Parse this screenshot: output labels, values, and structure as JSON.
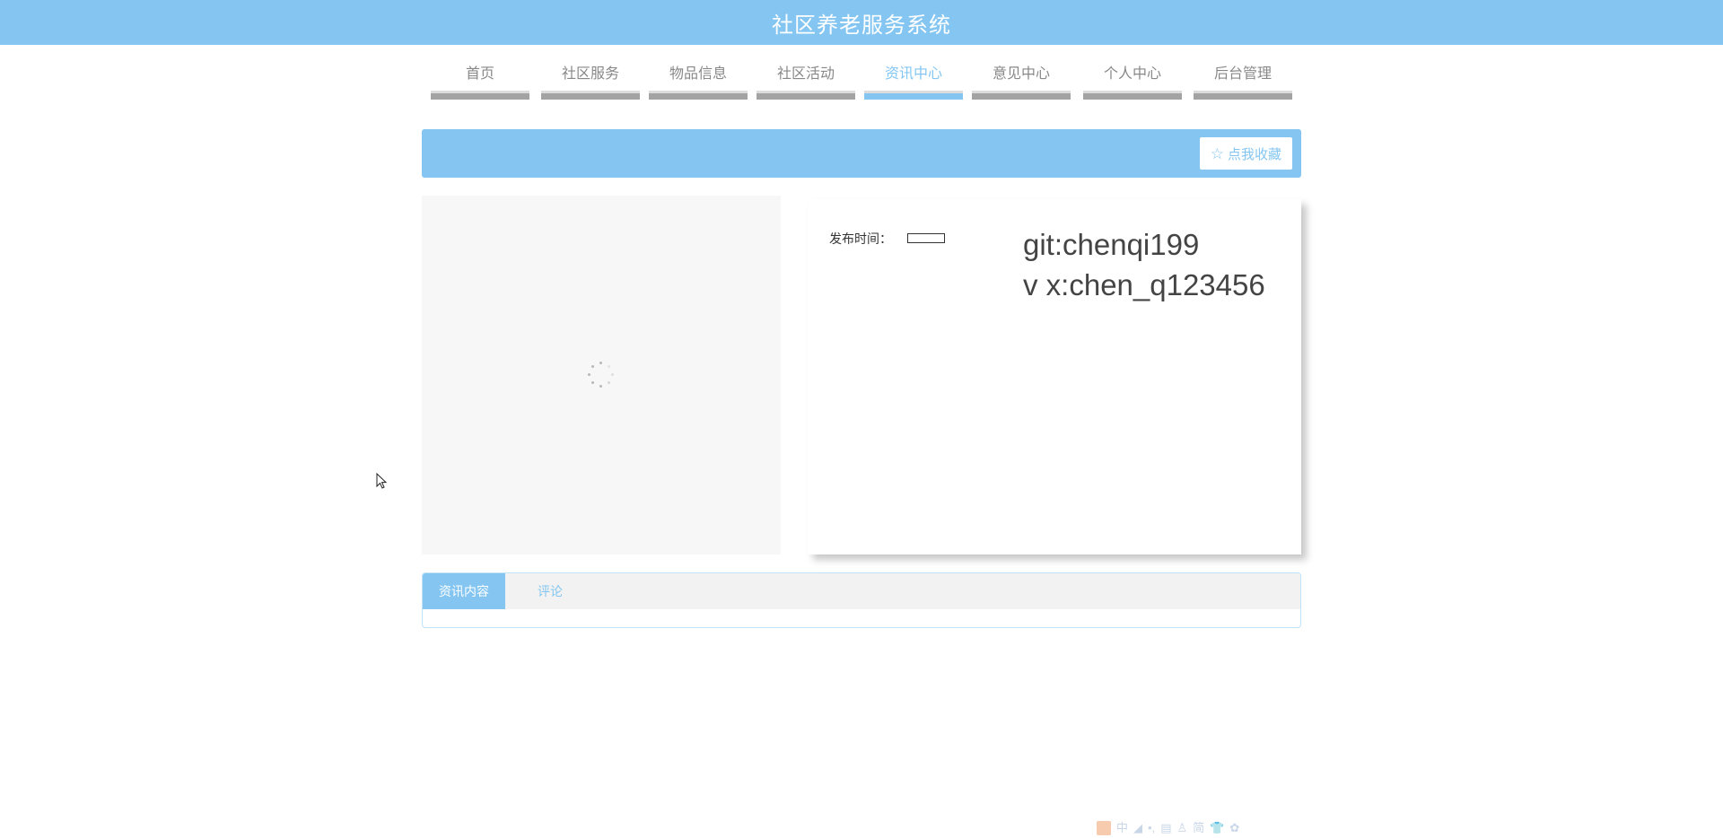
{
  "header": {
    "title": "社区养老服务系统"
  },
  "nav": {
    "items": [
      {
        "label": "首页",
        "active": false
      },
      {
        "label": "社区服务",
        "active": false
      },
      {
        "label": "物品信息",
        "active": false
      },
      {
        "label": "社区活动",
        "active": false
      },
      {
        "label": "资讯中心",
        "active": true
      },
      {
        "label": "意见中心",
        "active": false
      },
      {
        "label": "个人中心",
        "active": false
      },
      {
        "label": "后台管理",
        "active": false
      }
    ]
  },
  "banner": {
    "favorite_label": "点我收藏",
    "favorite_icon": "star-outline-icon"
  },
  "detail": {
    "publish_time_label": "发布时间：",
    "publish_time_value": "",
    "watermark_line1": "git:chenqi199",
    "watermark_line2": "v x:chen_q123456"
  },
  "tabs": {
    "items": [
      "资讯内容",
      "评论"
    ],
    "active_index": 0
  },
  "ime_toolbar": {
    "items": [
      "中",
      "◢",
      "•,",
      "▤",
      "♙",
      "简",
      "👕",
      "✿"
    ]
  },
  "colors": {
    "accent": "#84c6f1",
    "nav_bar": "#a3a3a3",
    "image_bg": "#f7f7f7"
  }
}
